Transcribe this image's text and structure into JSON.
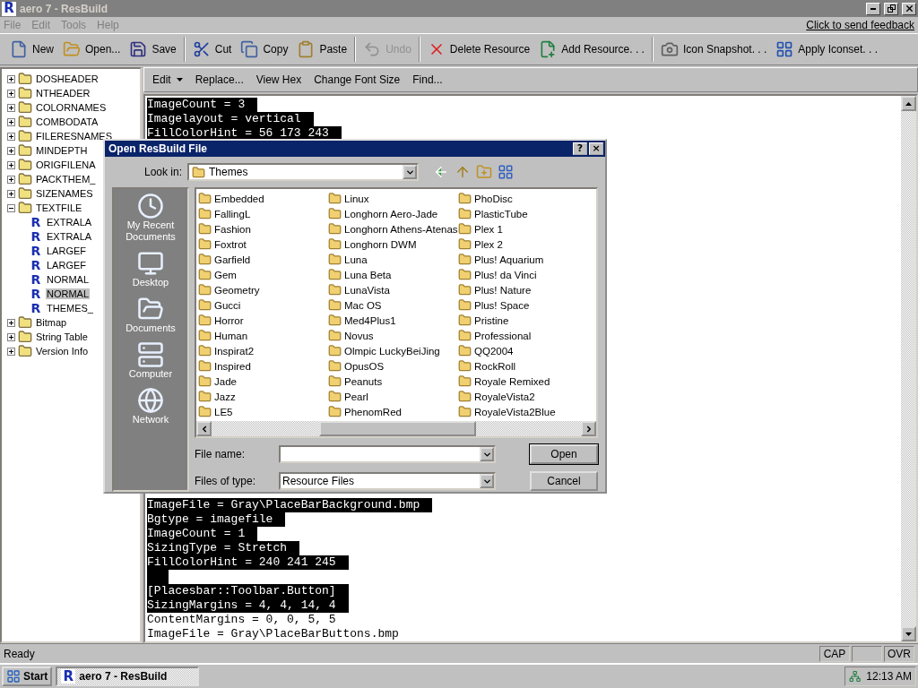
{
  "window": {
    "icon": "R",
    "title": "aero 7 - ResBuild",
    "active": false
  },
  "menu": [
    {
      "label": "File",
      "disabled": true
    },
    {
      "label": "Edit",
      "disabled": true
    },
    {
      "label": "Tools",
      "disabled": true
    },
    {
      "label": "Help",
      "disabled": true
    }
  ],
  "feedback_link": "Click to send feedback",
  "toolbar": [
    {
      "kind": "button",
      "label": "New",
      "disabled": false
    },
    {
      "kind": "button",
      "label": "Open...",
      "disabled": false
    },
    {
      "kind": "button",
      "label": "Save",
      "disabled": false
    },
    {
      "kind": "separator"
    },
    {
      "kind": "button",
      "label": "Cut",
      "disabled": false
    },
    {
      "kind": "button",
      "label": "Copy",
      "disabled": false
    },
    {
      "kind": "button",
      "label": "Paste",
      "disabled": false
    },
    {
      "kind": "separator"
    },
    {
      "kind": "button",
      "label": "Undo",
      "disabled": true
    },
    {
      "kind": "separator"
    },
    {
      "kind": "button",
      "label": "Delete Resource",
      "disabled": false
    },
    {
      "kind": "button",
      "label": "Add Resource. . .",
      "disabled": false
    },
    {
      "kind": "separator"
    },
    {
      "kind": "button",
      "label": "Icon Snapshot. . .",
      "disabled": false
    },
    {
      "kind": "button",
      "label": "Apply Iconset. . .",
      "disabled": false
    }
  ],
  "tree": [
    {
      "kind": "folder",
      "label": "DOSHEADER",
      "expanded": false,
      "selected": false
    },
    {
      "kind": "folder",
      "label": "NTHEADER",
      "expanded": false,
      "selected": false
    },
    {
      "kind": "folder",
      "label": "COLORNAMES",
      "expanded": false,
      "selected": false
    },
    {
      "kind": "folder",
      "label": "COMBODATA",
      "expanded": false,
      "selected": false
    },
    {
      "kind": "folder",
      "label": "FILERESNAMES",
      "expanded": false,
      "selected": false
    },
    {
      "kind": "folder",
      "label": "MINDEPTH",
      "expanded": false,
      "selected": false
    },
    {
      "kind": "folder",
      "label": "ORIGFILENA",
      "expanded": false,
      "selected": false
    },
    {
      "kind": "folder",
      "label": "PACKTHEM_",
      "expanded": false,
      "selected": false
    },
    {
      "kind": "folder",
      "label": "SIZENAMES",
      "expanded": false,
      "selected": false
    },
    {
      "kind": "folder",
      "label": "TEXTFILE",
      "expanded": true,
      "selected": false,
      "children": [
        {
          "kind": "resource",
          "glyph": "R",
          "label": "EXTRALA",
          "selected": false
        },
        {
          "kind": "resource",
          "glyph": "R",
          "label": "EXTRALA",
          "selected": false
        },
        {
          "kind": "resource",
          "glyph": "R",
          "label": "LARGEF",
          "selected": false
        },
        {
          "kind": "resource",
          "glyph": "R",
          "label": "LARGEF",
          "selected": false
        },
        {
          "kind": "resource",
          "glyph": "R",
          "label": "NORMAL",
          "selected": false
        },
        {
          "kind": "resource",
          "glyph": "R",
          "label": "NORMAL",
          "selected": true
        },
        {
          "kind": "resource",
          "glyph": "R",
          "label": "THEMES_",
          "selected": false
        }
      ]
    },
    {
      "kind": "folder",
      "label": "Bitmap",
      "expanded": false,
      "selected": false
    },
    {
      "kind": "folder",
      "label": "String Table",
      "expanded": false,
      "selected": false
    },
    {
      "kind": "folder",
      "label": "Version Info",
      "expanded": false,
      "selected": false
    }
  ],
  "editor_toolbar": [
    {
      "label": "Edit",
      "dropdown": true
    },
    {
      "label": "Replace...",
      "dropdown": false
    },
    {
      "label": "View Hex",
      "dropdown": false
    },
    {
      "label": "Change Font Size",
      "dropdown": false
    },
    {
      "label": "Find...",
      "dropdown": false
    }
  ],
  "editor": {
    "lines_top": [
      {
        "text": "ImageCount = 3",
        "selected": true
      },
      {
        "text": "Imagelayout = vertical",
        "selected": true
      },
      {
        "text": "FillColorHint = 56 173 243",
        "selected": true
      }
    ],
    "lines_bottom": [
      {
        "text": "ImageFile = Gray\\PlaceBarBackground.bmp",
        "selected": true
      },
      {
        "text": "Bgtype = imagefile",
        "selected": true
      },
      {
        "text": "ImageCount = 1",
        "selected": true
      },
      {
        "text": "SizingType = Stretch",
        "selected": true
      },
      {
        "text": "FillColorHint = 240 241 245",
        "selected": true
      },
      {
        "selected": true
      },
      {
        "text": "[Placesbar::Toolbar.Button]",
        "selected": true
      },
      {
        "text": "SizingMargins = 4, 4, 14, 4",
        "selected": true
      },
      {
        "text": "ContentMargins = 0, 0, 5, 5",
        "selected": false
      },
      {
        "text": "ImageFile = Gray\\PlaceBarButtons.bmp",
        "selected": false
      }
    ]
  },
  "dialog": {
    "title": "Open ResBuild File",
    "help": "?",
    "close": "×",
    "look_in_label": "Look in:",
    "look_in": "Themes",
    "places": [
      {
        "label": "My Recent Documents"
      },
      {
        "label": "Desktop"
      },
      {
        "label": "Documents"
      },
      {
        "label": "Computer"
      },
      {
        "label": "Network"
      }
    ],
    "files": [
      [
        "Embedded",
        "FallingL",
        "Fashion",
        "Foxtrot",
        "Garfield",
        "Gem",
        "Geometry",
        "Gucci",
        "Horror",
        "Human",
        "Inspirat2",
        "Inspired",
        "Jade",
        "Jazz",
        "LE5"
      ],
      [
        "Linux",
        "Longhorn Aero-Jade",
        "Longhorn Athens-Atenas",
        "Longhorn DWM",
        "Luna",
        "Luna Beta",
        "LunaVista",
        "Mac OS",
        "Med4Plus1",
        "Novus",
        "Olmpic LuckyBeiJing",
        "OpusOS",
        "Peanuts",
        "Pearl",
        "PhenomRed"
      ],
      [
        "PhoDisc",
        "PlasticTube",
        "Plex 1",
        "Plex 2",
        "Plus! Aquarium",
        "Plus! da Vinci",
        "Plus! Nature",
        "Plus! Space",
        "Pristine",
        "Professional",
        "QQ2004",
        "RockRoll",
        "Royale Remixed",
        "RoyaleVista2",
        "RoyaleVista2Blue"
      ]
    ],
    "file_name_label": "File name:",
    "files_of_type_label": "Files of type:",
    "files_of_type": "Resource Files",
    "buttons": [
      {
        "label": "Open",
        "default": true
      },
      {
        "label": "Cancel",
        "default": false
      }
    ]
  },
  "status_bar": {
    "text": "Ready",
    "panels": [
      {
        "label": "CAP"
      },
      {
        "label": "OVR"
      }
    ]
  },
  "taskbar": {
    "start": "Start",
    "tasks": [
      {
        "icon": "R",
        "label": "aero 7 - ResBuild",
        "selected": true
      }
    ],
    "clock": "12:13 AM"
  }
}
